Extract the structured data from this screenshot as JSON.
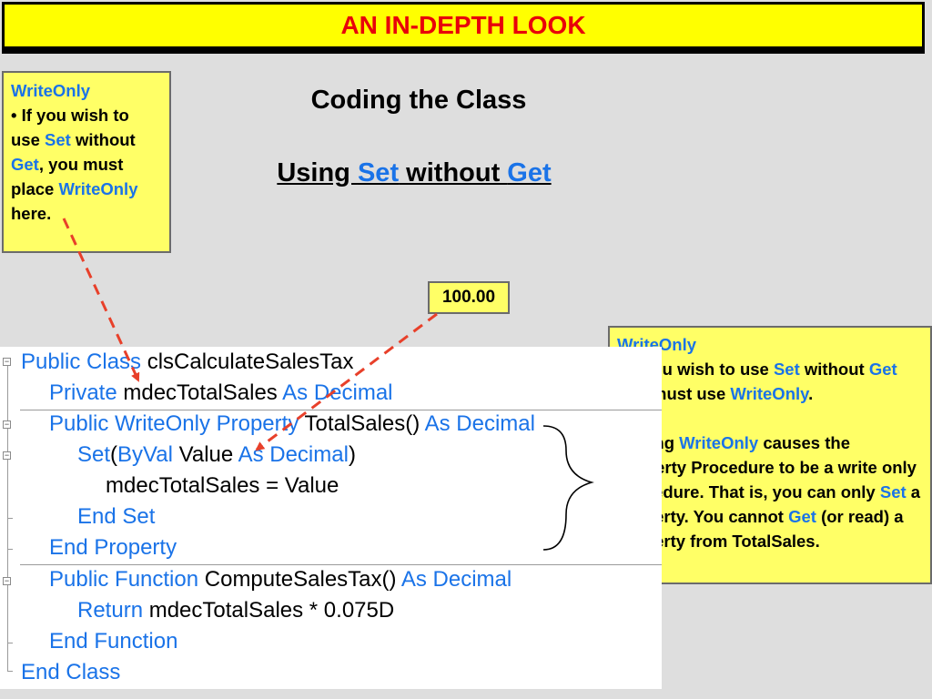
{
  "title": "AN IN-DEPTH LOOK",
  "heading": "Coding the Class",
  "subheading": {
    "p1": "Using ",
    "p2": "Set",
    "p3": " without ",
    "p4": "Get"
  },
  "value_box": "100.00",
  "note_left": {
    "title": "WriteOnly",
    "t1": "• If you wish to use ",
    "k1": "Set",
    "t2": " without ",
    "k2": "Get",
    "t3": ", you must place ",
    "k3": "WriteOnly",
    "t4": " here."
  },
  "note_right": {
    "title": "WriteOnly",
    "a1": "• If you wish to use ",
    "a_k1": "Set",
    "a2": " without ",
    "a_k2": "Get",
    "a3": " you must use ",
    "a_k3": "WriteOnly",
    "a4": ".",
    "b1": "• Using ",
    "b_k1": "WriteOnly",
    "b2": " causes the Property Procedure to be a write only procedure.  That is, you can only ",
    "b_k2": "Set",
    "b3": " a property. You cannot ",
    "b_k3": "Get",
    "b4": " (or read) a property from TotalSales."
  },
  "code": [
    {
      "k1": "Public Class",
      "t1": " clsCalculateSalesTax"
    },
    {
      "k1": "Private",
      "t1": " mdecTotalSales ",
      "k2": "As Decimal"
    },
    {
      "k1": "Public WriteOnly Property",
      "t1": " TotalSales() ",
      "k2": "As Decimal"
    },
    {
      "k1": "Set",
      "t1": "(",
      "k2": "ByVal",
      "t2": " Value ",
      "k3": "As Decimal",
      "t3": ")"
    },
    {
      "t1": "mdecTotalSales = Value"
    },
    {
      "k1": "End Set"
    },
    {
      "k1": "End Property"
    },
    {
      "k1": "Public Function",
      "t1": " ComputeSalesTax() ",
      "k2": "As Decimal"
    },
    {
      "k1": "Return",
      "t1": " mdecTotalSales * 0.075D"
    },
    {
      "k1": "End Function"
    },
    {
      "k1": "End Class"
    }
  ],
  "colors": {
    "title_bg": "#ffff00",
    "title_text": "#e8000a",
    "note_bg": "#ffff66",
    "keyword": "#1a73e8",
    "arrow": "#e8402a"
  }
}
